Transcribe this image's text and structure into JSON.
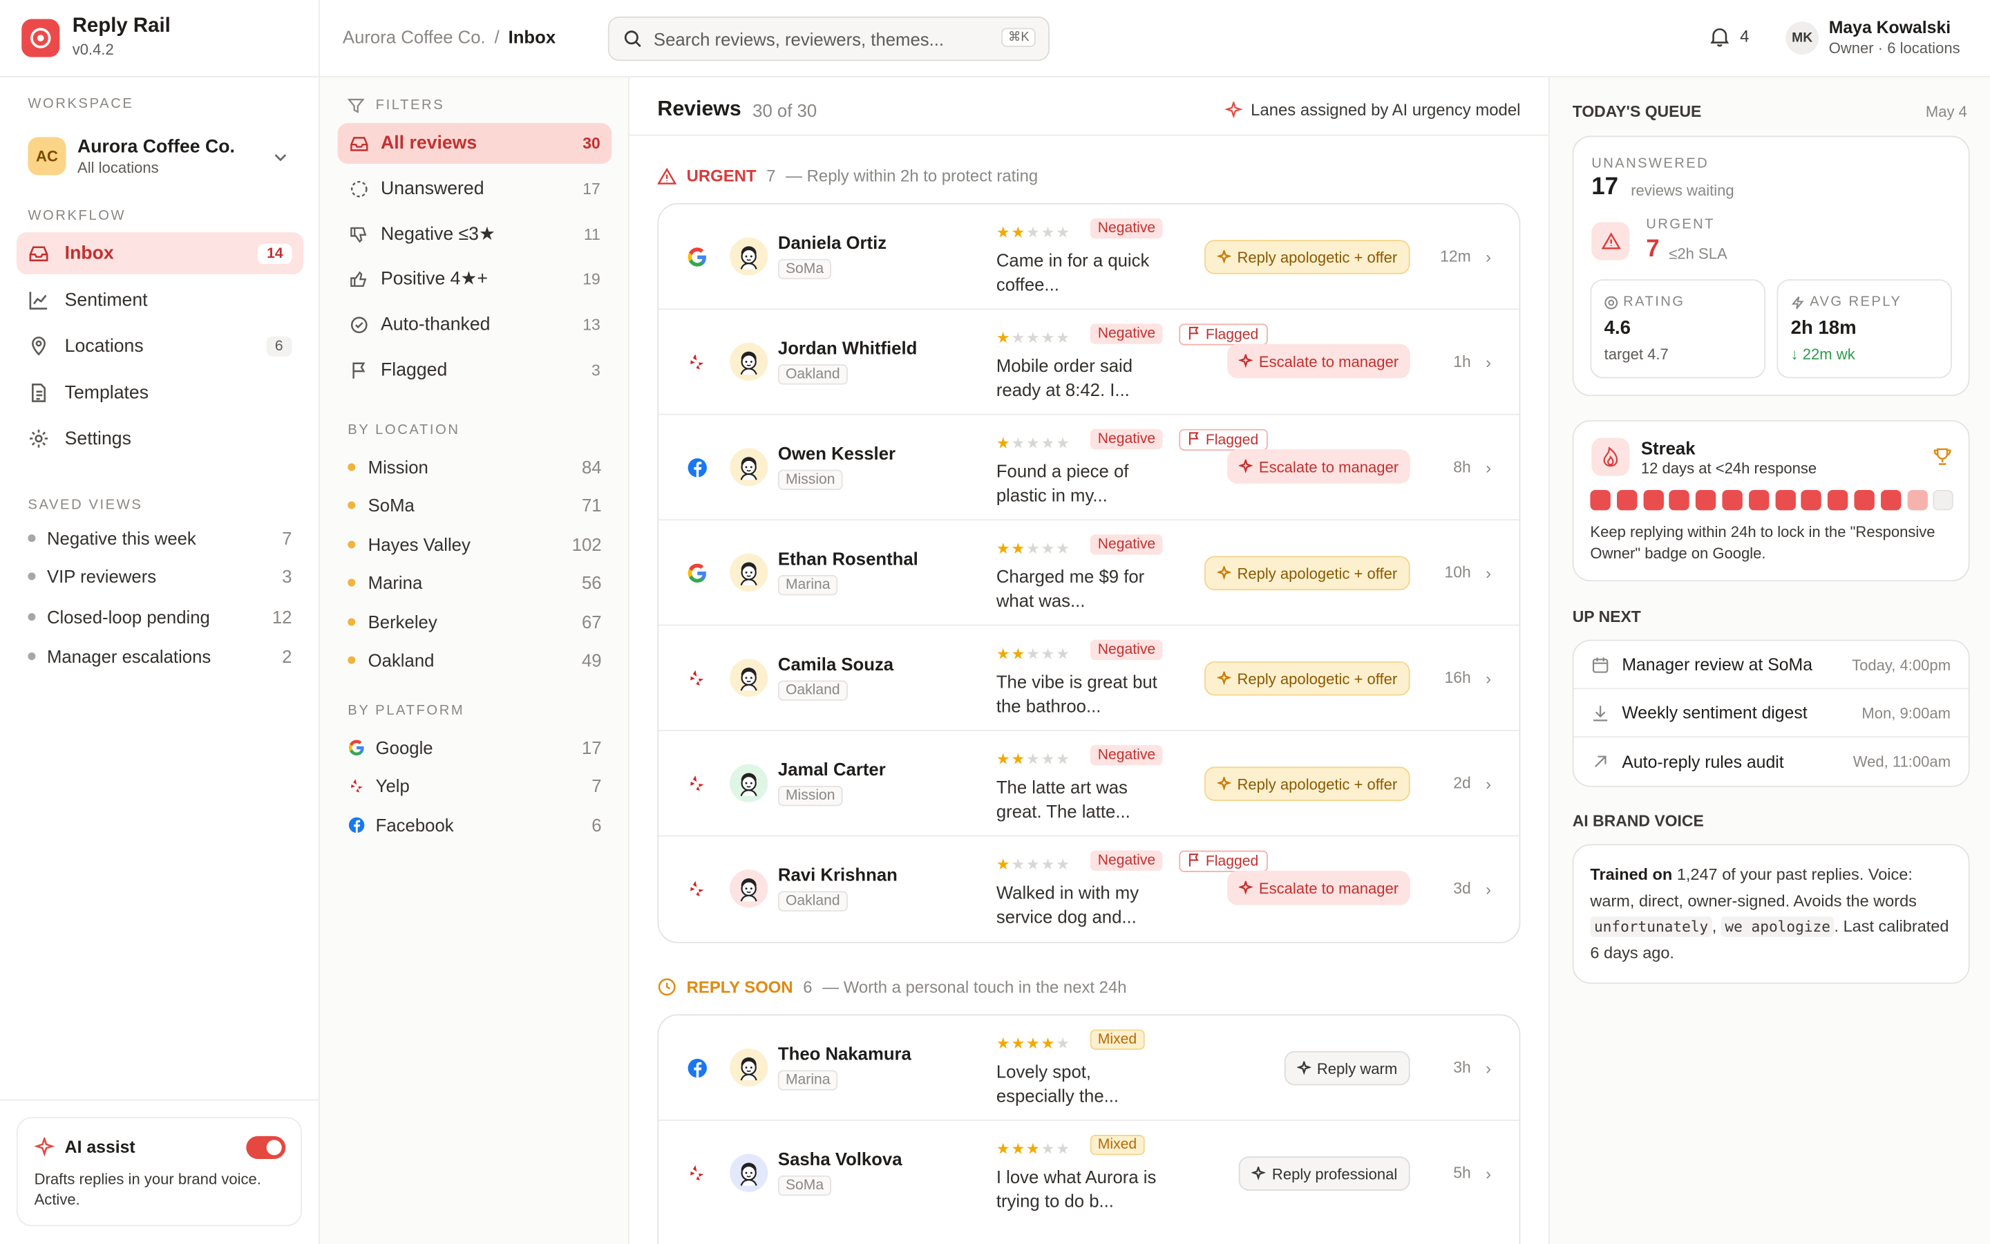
{
  "brand": {
    "name": "Reply Rail",
    "version": "v0.4.2"
  },
  "workspace_label": "WORKSPACE",
  "workspace": {
    "initials": "AC",
    "name": "Aurora Coffee Co.",
    "sub": "All locations"
  },
  "workflow_label": "WORKFLOW",
  "nav": [
    {
      "label": "Inbox",
      "count": "14"
    },
    {
      "label": "Sentiment"
    },
    {
      "label": "Locations",
      "count": "6"
    },
    {
      "label": "Templates"
    },
    {
      "label": "Settings"
    }
  ],
  "saved_label": "SAVED VIEWS",
  "saved_views": [
    {
      "label": "Negative this week",
      "count": "7"
    },
    {
      "label": "VIP reviewers",
      "count": "3"
    },
    {
      "label": "Closed-loop pending",
      "count": "12"
    },
    {
      "label": "Manager escalations",
      "count": "2"
    }
  ],
  "ai_assist": {
    "title": "AI assist",
    "desc": "Drafts replies in your brand voice. Active.",
    "enabled": true
  },
  "breadcrumb": {
    "parent": "Aurora Coffee Co.",
    "sep": "/",
    "current": "Inbox"
  },
  "search": {
    "placeholder": "Search reviews, reviewers, themes...",
    "shortcut": "⌘K"
  },
  "notifications": "4",
  "user": {
    "initials": "MK",
    "name": "Maya Kowalski",
    "role": "Owner · 6 locations"
  },
  "filters_label": "FILTERS",
  "filters": [
    {
      "label": "All reviews",
      "count": "30"
    },
    {
      "label": "Unanswered",
      "count": "17"
    },
    {
      "label": "Negative ≤3★",
      "count": "11"
    },
    {
      "label": "Positive 4★+",
      "count": "19"
    },
    {
      "label": "Auto-thanked",
      "count": "13"
    },
    {
      "label": "Flagged",
      "count": "3"
    }
  ],
  "by_location_label": "BY LOCATION",
  "locations": [
    {
      "label": "Mission",
      "count": "84"
    },
    {
      "label": "SoMa",
      "count": "71"
    },
    {
      "label": "Hayes Valley",
      "count": "102"
    },
    {
      "label": "Marina",
      "count": "56"
    },
    {
      "label": "Berkeley",
      "count": "67"
    },
    {
      "label": "Oakland",
      "count": "49"
    }
  ],
  "by_platform_label": "BY PLATFORM",
  "platforms": [
    {
      "label": "Google",
      "count": "17"
    },
    {
      "label": "Yelp",
      "count": "7"
    },
    {
      "label": "Facebook",
      "count": "6"
    }
  ],
  "main": {
    "title": "Reviews",
    "count": "30 of 30",
    "note": "Lanes assigned by AI urgency model"
  },
  "urgent": {
    "label": "URGENT",
    "count": "7",
    "desc": "— Reply within 2h to protect rating"
  },
  "urgent_reviews": [
    {
      "platform": "google",
      "name": "Daniela Ortiz",
      "location": "SoMa",
      "rating": 2,
      "tag": "Negative",
      "flagged": false,
      "snippet": "Came in for a quick coffee...",
      "action": "Reply apologetic + offer",
      "action_type": "apo",
      "time": "12m",
      "avatar_bg": "#fdf0cf"
    },
    {
      "platform": "yelp",
      "name": "Jordan Whitfield",
      "location": "Oakland",
      "rating": 1,
      "tag": "Negative",
      "flagged": true,
      "snippet": "Mobile order said ready at 8:42. I...",
      "action": "Escalate to manager",
      "action_type": "esc",
      "time": "1h",
      "avatar_bg": "#fdf0cf"
    },
    {
      "platform": "facebook",
      "name": "Owen Kessler",
      "location": "Mission",
      "rating": 1,
      "tag": "Negative",
      "flagged": true,
      "snippet": "Found a piece of plastic in my...",
      "action": "Escalate to manager",
      "action_type": "esc",
      "time": "8h",
      "avatar_bg": "#fdf0cf"
    },
    {
      "platform": "google",
      "name": "Ethan Rosenthal",
      "location": "Marina",
      "rating": 2,
      "tag": "Negative",
      "flagged": false,
      "snippet": "Charged me $9 for what was...",
      "action": "Reply apologetic + offer",
      "action_type": "apo",
      "time": "10h",
      "avatar_bg": "#fdf0cf"
    },
    {
      "platform": "yelp",
      "name": "Camila Souza",
      "location": "Oakland",
      "rating": 2,
      "tag": "Negative",
      "flagged": false,
      "snippet": "The vibe is great but the bathroo...",
      "action": "Reply apologetic + offer",
      "action_type": "apo",
      "time": "16h",
      "avatar_bg": "#fdf0cf"
    },
    {
      "platform": "yelp",
      "name": "Jamal Carter",
      "location": "Mission",
      "rating": 2,
      "tag": "Negative",
      "flagged": false,
      "snippet": "The latte art was great. The latte...",
      "action": "Reply apologetic + offer",
      "action_type": "apo",
      "time": "2d",
      "avatar_bg": "#dff5e6"
    },
    {
      "platform": "yelp",
      "name": "Ravi Krishnan",
      "location": "Oakland",
      "rating": 1,
      "tag": "Negative",
      "flagged": true,
      "snippet": "Walked in with my service dog and...",
      "action": "Escalate to manager",
      "action_type": "esc",
      "time": "3d",
      "avatar_bg": "#fde3e1"
    }
  ],
  "flagged_label": "Flagged",
  "soon": {
    "label": "REPLY SOON",
    "count": "6",
    "desc": "— Worth a personal touch in the next 24h"
  },
  "soon_reviews": [
    {
      "platform": "facebook",
      "name": "Theo Nakamura",
      "location": "Marina",
      "rating": 4,
      "tag": "Mixed",
      "flagged": false,
      "snippet": "Lovely spot, especially the...",
      "action": "Reply warm",
      "action_type": "warm",
      "time": "3h",
      "avatar_bg": "#fdf0cf"
    },
    {
      "platform": "yelp",
      "name": "Sasha Volkova",
      "location": "SoMa",
      "rating": 3,
      "tag": "Mixed",
      "flagged": false,
      "snippet": "I love what Aurora is trying to do b...",
      "action": "Reply professional",
      "action_type": "warm",
      "time": "5h",
      "avatar_bg": "#e3e8fb"
    }
  ],
  "queue": {
    "title": "TODAY'S QUEUE",
    "date": "May 4",
    "unanswered_label": "UNANSWERED",
    "unanswered": "17",
    "unanswered_sub": "reviews waiting",
    "urgent_label": "URGENT",
    "urgent": "7",
    "urgent_sub": "≤2h SLA",
    "rating_label": "RATING",
    "rating": "4.6",
    "rating_sub": "target 4.7",
    "avg_label": "AVG REPLY",
    "avg": "2h 18m",
    "avg_sub": "↓ 22m wk"
  },
  "streak": {
    "title": "Streak",
    "sub": "12 days at <24h response",
    "filled": 12,
    "total": 14,
    "desc": "Keep replying within 24h to lock in the \"Responsive Owner\" badge on Google."
  },
  "up_next_label": "UP NEXT",
  "up_next": [
    {
      "label": "Manager review at SoMa",
      "when": "Today, 4:00pm",
      "icon": "calendar-icon"
    },
    {
      "label": "Weekly sentiment digest",
      "when": "Mon, 9:00am",
      "icon": "download-icon"
    },
    {
      "label": "Auto-reply rules audit",
      "when": "Wed, 11:00am",
      "icon": "arrow-up-right-icon"
    }
  ],
  "brand_voice_label": "AI BRAND VOICE",
  "brand_voice": {
    "lead": "Trained on",
    "count": "1,247",
    "t1": "of your past replies. Voice: warm, direct, owner-signed. Avoids the words",
    "w1": "unfortunately",
    "comma": ",",
    "w2": "we apologize",
    "t2": ". Last calibrated 6 days ago."
  },
  "colors": {
    "accent": "#e5483f",
    "urgent": "#d93a3a",
    "soon": "#e08a10",
    "star": "#f2a900"
  }
}
